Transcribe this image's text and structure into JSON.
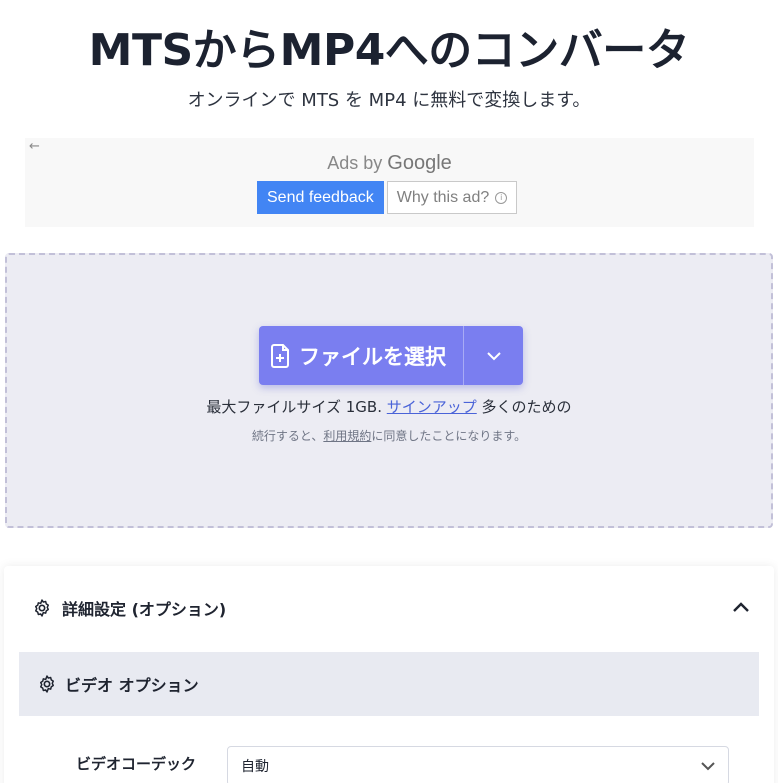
{
  "header": {
    "title": "MTSからMP4へのコンバータ",
    "subtitle": "オンラインで MTS を MP4 に無料で変換します。"
  },
  "ad": {
    "back_arrow": "←",
    "ads_by": "Ads by",
    "google": "Google",
    "send_feedback": "Send feedback",
    "why_this_ad": "Why this ad?",
    "info_glyph": "i"
  },
  "upload": {
    "choose_file_label": "ファイルを選択",
    "limit_prefix": "最大ファイルサイズ 1GB.",
    "signup_link": "サインアップ",
    "limit_suffix": "多くのための",
    "terms_prefix": "続行すると、",
    "terms_link": "利用規約",
    "terms_suffix": "に同意したことになります。",
    "accent_color": "#7a7ef0"
  },
  "settings": {
    "header_label": "詳細設定 (オプション)",
    "video_section_label": "ビデオ オプション",
    "codec_label": "ビデオコーデック",
    "codec_value": "自動"
  },
  "icons": {
    "settings": "gear-icon",
    "file_add": "file-plus-icon",
    "dropdown": "chevron-down-icon",
    "collapse": "chevron-up-icon"
  }
}
